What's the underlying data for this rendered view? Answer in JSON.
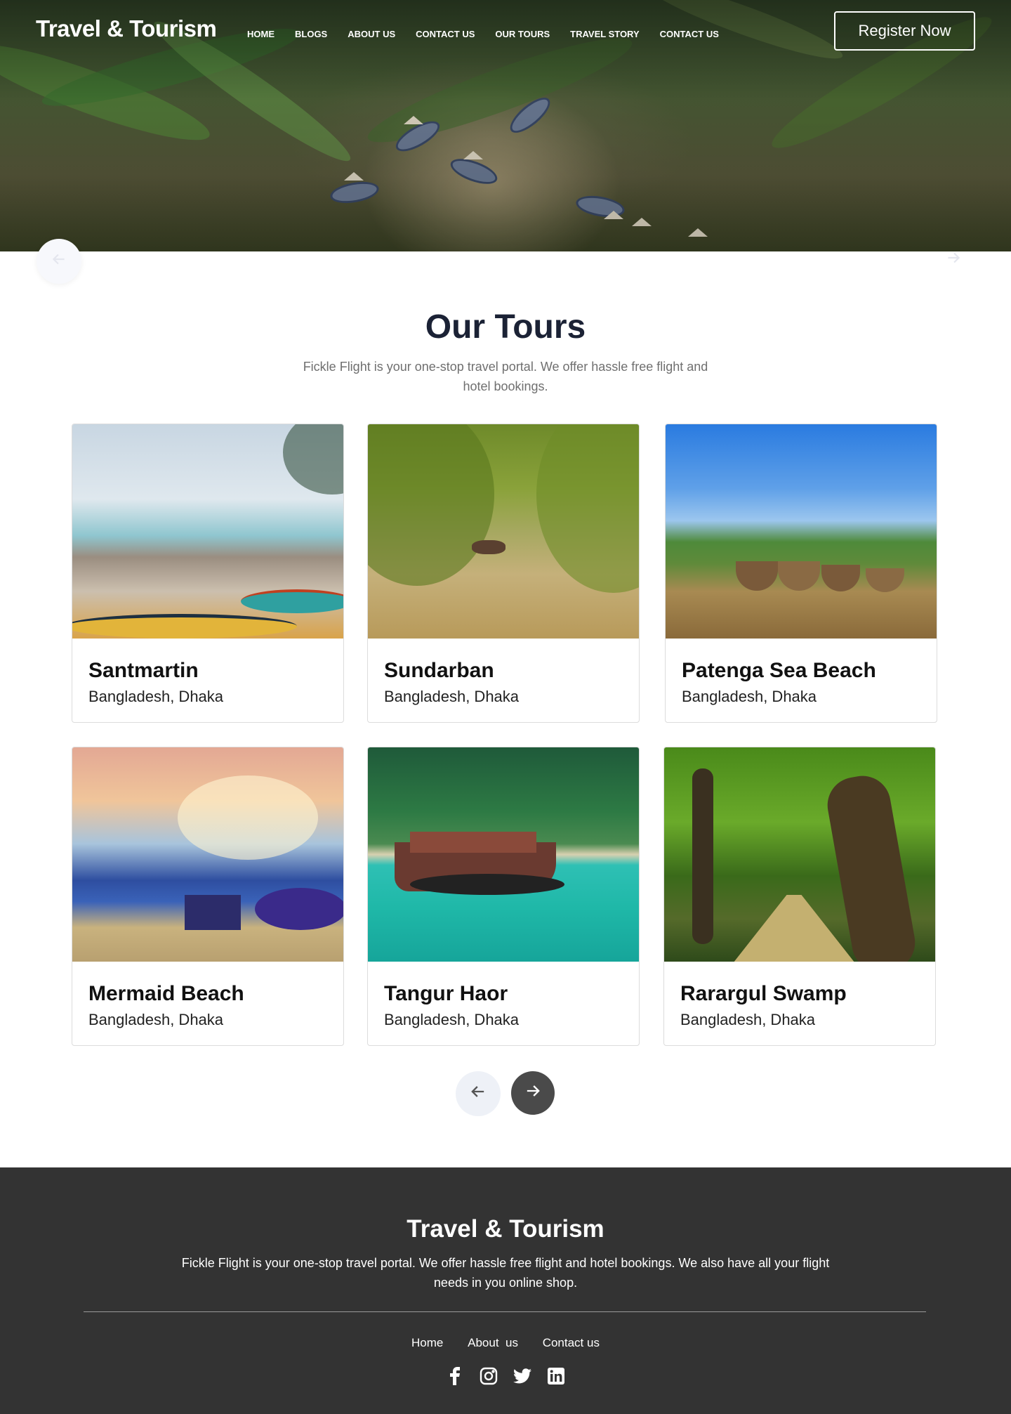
{
  "header": {
    "brand": "Travel & Tourism",
    "nav": [
      "HOME",
      "BLOGS",
      "ABOUT US",
      "CONTACT US",
      "OUR TOURS",
      "TRAVEL STORY",
      "CONTACT US"
    ],
    "register_label": "Register Now"
  },
  "hero_slider": {
    "prev_icon": "arrow-left-icon",
    "next_icon": "arrow-right-icon"
  },
  "tours": {
    "title": "Our Tours",
    "subtitle": "Fickle Flight is your one-stop travel portal. We offer hassle free flight and hotel bookings.",
    "cards": [
      {
        "name": "Santmartin",
        "location": "Bangladesh, Dhaka"
      },
      {
        "name": "Sundarban",
        "location": "Bangladesh, Dhaka"
      },
      {
        "name": "Patenga Sea Beach",
        "location": "Bangladesh, Dhaka"
      },
      {
        "name": "Mermaid Beach",
        "location": "Bangladesh, Dhaka"
      },
      {
        "name": "Tangur Haor",
        "location": "Bangladesh, Dhaka"
      },
      {
        "name": "Rarargul Swamp",
        "location": "Bangladesh, Dhaka"
      }
    ],
    "pager_prev_icon": "arrow-left-icon",
    "pager_next_icon": "arrow-right-icon"
  },
  "footer": {
    "brand": "Travel & Tourism",
    "description": "Fickle Flight is your one-stop travel portal. We offer hassle free flight and hotel bookings. We also have all your flight needs in you online shop.",
    "links": [
      "Home",
      "About  us",
      "Contact us"
    ],
    "social": [
      "facebook-icon",
      "instagram-icon",
      "twitter-icon",
      "linkedin-icon"
    ]
  },
  "colors": {
    "heading": "#1b2235",
    "footer_bg": "#333333",
    "pager_active": "#4a4a4a"
  }
}
